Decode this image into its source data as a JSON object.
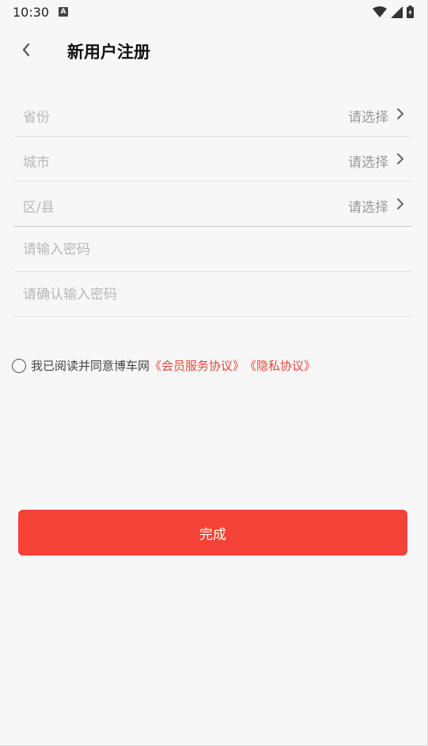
{
  "status_bar": {
    "time": "10:30",
    "notification_badge": "A",
    "icons": [
      "wifi-icon",
      "signal-icon",
      "battery-icon"
    ]
  },
  "header": {
    "title": "新用户注册"
  },
  "form": {
    "province": {
      "label": "省份",
      "value": "请选择"
    },
    "city": {
      "label": "城市",
      "value": "请选择"
    },
    "district": {
      "label": "区/县",
      "value": "请选择"
    },
    "password": {
      "placeholder": "请输入密码",
      "value": ""
    },
    "confirm_password": {
      "placeholder": "请确认输入密码",
      "value": ""
    }
  },
  "agreement": {
    "checked": false,
    "text": "我已阅读并同意博车网",
    "member_link": "《会员服务协议》",
    "privacy_link": "《隐私协议》"
  },
  "submit_label": "完成",
  "colors": {
    "accent": "#f44336",
    "link": "#e8453c",
    "background": "#f7f7f7",
    "placeholder": "#b8b8b8"
  }
}
